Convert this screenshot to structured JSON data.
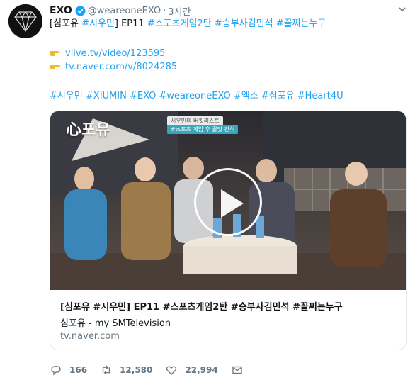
{
  "tweet": {
    "author_name": "EXO",
    "handle": "@weareoneEXO",
    "separator": "·",
    "time": "3시간",
    "line1": {
      "prefix": "[심포유",
      "tag1": "#시우민",
      "mid": "] EP11",
      "tag2": "#스포츠게임2탄",
      "tag3": "#승부사김민석",
      "tag4": "#꼴찌는누구"
    },
    "link1": "vlive.tv/video/123595",
    "link2": "tv.naver.com/v/8024285",
    "hashtags": "#시우민 #XIUMIN #EXO #weareoneEXO #엑소 #심포유 #Heart4U"
  },
  "card": {
    "thumb_logo": "心포유",
    "thumb_caption_1": "시우민의 버킷리스트",
    "thumb_caption_2": "#스포츠 게임 후 꿀맛 간식",
    "title": "[심포유 #시우민] EP11 #스포츠게임2탄 #승부사김민석 #꼴찌는누구",
    "subtitle": "심포유 - my SMTelevision",
    "domain": "tv.naver.com"
  },
  "actions": {
    "replies": "166",
    "retweets": "12,580",
    "likes": "22,994"
  },
  "icons": {
    "avatar": "exo-logo-avatar",
    "verified": "verified-badge-icon",
    "pointer": "pointing-hand-emoji-icon",
    "reply": "reply-icon",
    "retweet": "retweet-icon",
    "like": "heart-icon",
    "dm": "envelope-icon",
    "menu": "chevron-down-icon",
    "play": "play-icon"
  },
  "colors": {
    "link": "#1da1f2",
    "muted": "#657786",
    "text": "#14171a",
    "border": "#e1e8ed"
  }
}
